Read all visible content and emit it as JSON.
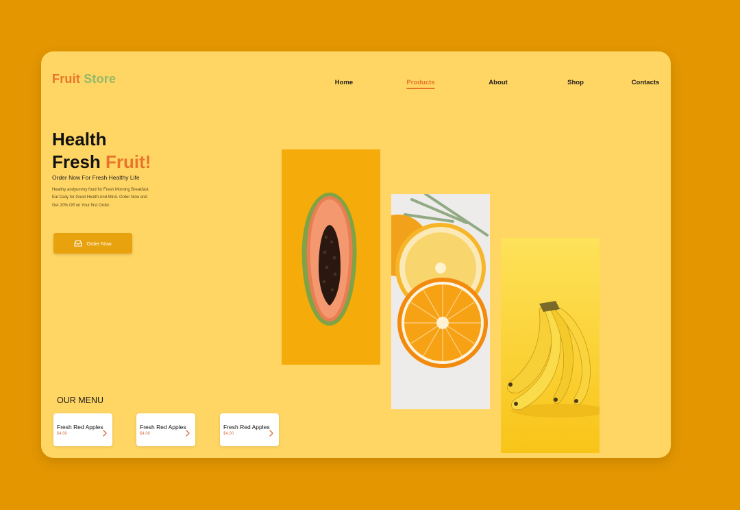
{
  "brand": {
    "word1": "Fruit",
    "word2": "Store"
  },
  "nav": [
    {
      "label": "Home",
      "active": false
    },
    {
      "label": "Products",
      "active": true
    },
    {
      "label": "About",
      "active": false
    },
    {
      "label": "Shop",
      "active": false
    },
    {
      "label": "Contacts",
      "active": false
    }
  ],
  "hero": {
    "line1": "Health",
    "line2a": "Fresh",
    "line2b": "Fruit!",
    "tagline": "Order Now For Fresh Healthy Life",
    "description": "Healthy andyummy food for Fresh Morning Breakfast. Eat Daily for Good Health And Mind. Order Now and Get 20% Off on Your first Order.",
    "cta": "Order Now",
    "cta_icon": "inbox-icon"
  },
  "menu": {
    "title": "OUR MENU",
    "items": [
      {
        "name": "Fresh Red Apples",
        "price": "$4.00"
      },
      {
        "name": "Fresh Red Apples",
        "price": "$4.00"
      },
      {
        "name": "Fresh Red Apples",
        "price": "$4.00"
      }
    ]
  },
  "gallery": [
    "papaya-photo",
    "orange-photo",
    "banana-photo"
  ],
  "colors": {
    "background": "#E39600",
    "card": "#FFD564",
    "accent": "#E8742A",
    "green": "#93B96A",
    "button": "#E8A20E"
  }
}
